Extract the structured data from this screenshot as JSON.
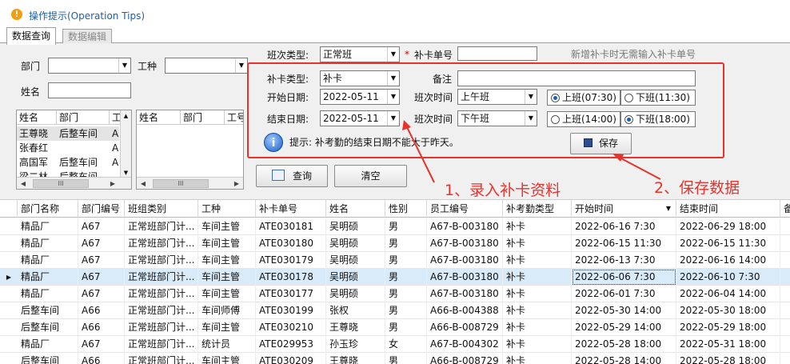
{
  "title": "操作提示(Operation Tips)",
  "tabs": [
    {
      "label": "数据查询",
      "active": true
    },
    {
      "label": "数据编辑",
      "active": false
    }
  ],
  "filters": {
    "dept_label": "部门",
    "job_label": "工种",
    "name_label": "姓名",
    "dept_value": "",
    "job_value": "",
    "name_value": ""
  },
  "mini_grid_left": {
    "headers": [
      "姓名",
      "部门",
      "工"
    ],
    "rows": [
      [
        "王尊晓",
        "后整车间",
        "A"
      ],
      [
        "张春红",
        "",
        "A"
      ],
      [
        "高国军",
        "后整车间",
        "A"
      ],
      [
        "梁二林",
        "后整车间",
        ""
      ]
    ]
  },
  "mini_grid_right": {
    "headers": [
      "姓名",
      "部门",
      "工号"
    ]
  },
  "shift_type_label": "班次类型:",
  "shift_type_value": "正常班",
  "card_no_label": "补卡单号",
  "card_no_value": "",
  "card_no_hint": "新增补卡时无需输入补卡单号",
  "form": {
    "card_type_label": "补卡类型:",
    "card_type_value": "补卡",
    "remark_label": "备注",
    "remark_value": "",
    "start_date_label": "开始日期:",
    "start_date_value": "2022-05-11",
    "end_date_label": "结束日期:",
    "end_date_value": "2022-05-11",
    "shift_time_label_1": "班次时间",
    "shift_time_value_1": "上午班",
    "shift_time_label_2": "班次时间",
    "shift_time_value_2": "下午班",
    "radio_am_on": "上班(07:30)",
    "radio_am_off": "下班(11:30)",
    "radio_pm_on": "上班(14:00)",
    "radio_pm_off": "下班(18:00)",
    "tip": "提示: 补考勤的结束日期不能大于昨天。",
    "save_label": "保存"
  },
  "buttons": {
    "query_label": "查询",
    "clear_label": "清空"
  },
  "annotations": {
    "step1": "1、录入补卡资料",
    "step2": "2、保存数据"
  },
  "grid": {
    "headers": [
      "部门名称",
      "部门编号",
      "班组类别",
      "工种",
      "补卡单号",
      "姓名",
      "性别",
      "员工编号",
      "补考勤类型",
      "开始时间",
      "结束时间",
      "备"
    ],
    "sort_column": "开始时间",
    "rows": [
      [
        "精品厂",
        "A67",
        "正常班部门计...",
        "车间主管",
        "ATE030181",
        "吴明硕",
        "男",
        "A67-B-003180",
        "补卡",
        "2022-06-16 7:30",
        "2022-06-29 18:00"
      ],
      [
        "精品厂",
        "A67",
        "正常班部门计...",
        "车间主管",
        "ATE030180",
        "吴明硕",
        "男",
        "A67-B-003180",
        "补卡",
        "2022-06-15 11:30",
        "2022-06-15 11:30"
      ],
      [
        "精品厂",
        "A67",
        "正常班部门计...",
        "车间主管",
        "ATE030179",
        "吴明硕",
        "男",
        "A67-B-003180",
        "补卡",
        "2022-06-13 7:30",
        "2022-06-16 14:00"
      ],
      [
        "精品厂",
        "A67",
        "正常班部门计...",
        "车间主管",
        "ATE030178",
        "吴明硕",
        "男",
        "A67-B-003180",
        "补卡",
        "2022-06-06 7:30",
        "2022-06-10 7:30"
      ],
      [
        "精品厂",
        "A67",
        "正常班部门计...",
        "车间主管",
        "ATE030177",
        "吴明硕",
        "男",
        "A67-B-003180",
        "补卡",
        "2022-06-01 7:30",
        "2022-06-04 14:00"
      ],
      [
        "后整车间",
        "A66",
        "正常班部门计...",
        "车间师傅",
        "ATE030199",
        "张权",
        "男",
        "A66-B-004388",
        "补卡",
        "2022-05-30 14:00",
        "2022-05-30 18:00"
      ],
      [
        "后整车间",
        "A66",
        "正常班部门计...",
        "车间主管",
        "ATE030210",
        "王尊晓",
        "男",
        "A66-B-008729",
        "补卡",
        "2022-05-29 14:00",
        "2022-05-29 18:00"
      ],
      [
        "精品厂",
        "A67",
        "正常班部门计...",
        "统计员",
        "ATE029953",
        "孙玉珍",
        "女",
        "A67-B-004302",
        "补卡",
        "2022-05-28 18:00",
        "2022-05-31 18:00"
      ],
      [
        "后整车间",
        "A66",
        "正常班部门计...",
        "车间主管",
        "ATE030209",
        "王尊晓",
        "男",
        "A66-B-008729",
        "补卡",
        "2022-05-28 14:00",
        "2022-05-28 18:00"
      ]
    ],
    "selected_row": 3
  }
}
